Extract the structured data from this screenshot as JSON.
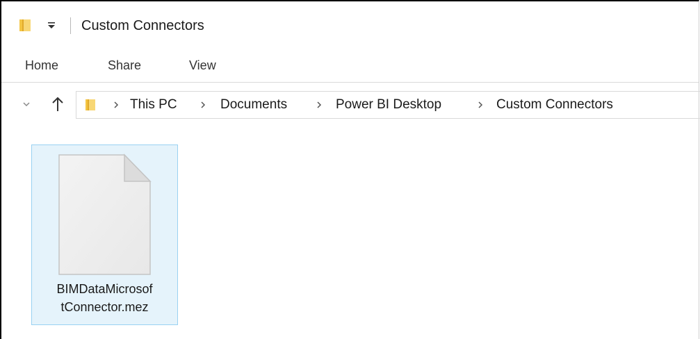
{
  "window": {
    "title": "Custom Connectors"
  },
  "ribbon": {
    "tabs": [
      {
        "label": "Home"
      },
      {
        "label": "Share"
      },
      {
        "label": "View"
      }
    ]
  },
  "navigation": {
    "recent_locations_icon": "chevron-down-icon",
    "up_icon": "arrow-up-icon"
  },
  "address_bar": {
    "folder_icon": "folder-icon",
    "breadcrumbs": [
      {
        "label": "This PC"
      },
      {
        "label": "Documents"
      },
      {
        "label": "Power BI Desktop"
      },
      {
        "label": "Custom Connectors"
      }
    ]
  },
  "files": [
    {
      "name_line1": "BIMDataMicrosof",
      "name_line2": "tConnector.mez",
      "icon": "generic-file-icon",
      "selected_style": "hover"
    }
  ],
  "colors": {
    "folder_yellow": "#f4c542",
    "selection_fill": "#e5f3fb",
    "selection_border": "#99d1f2"
  }
}
